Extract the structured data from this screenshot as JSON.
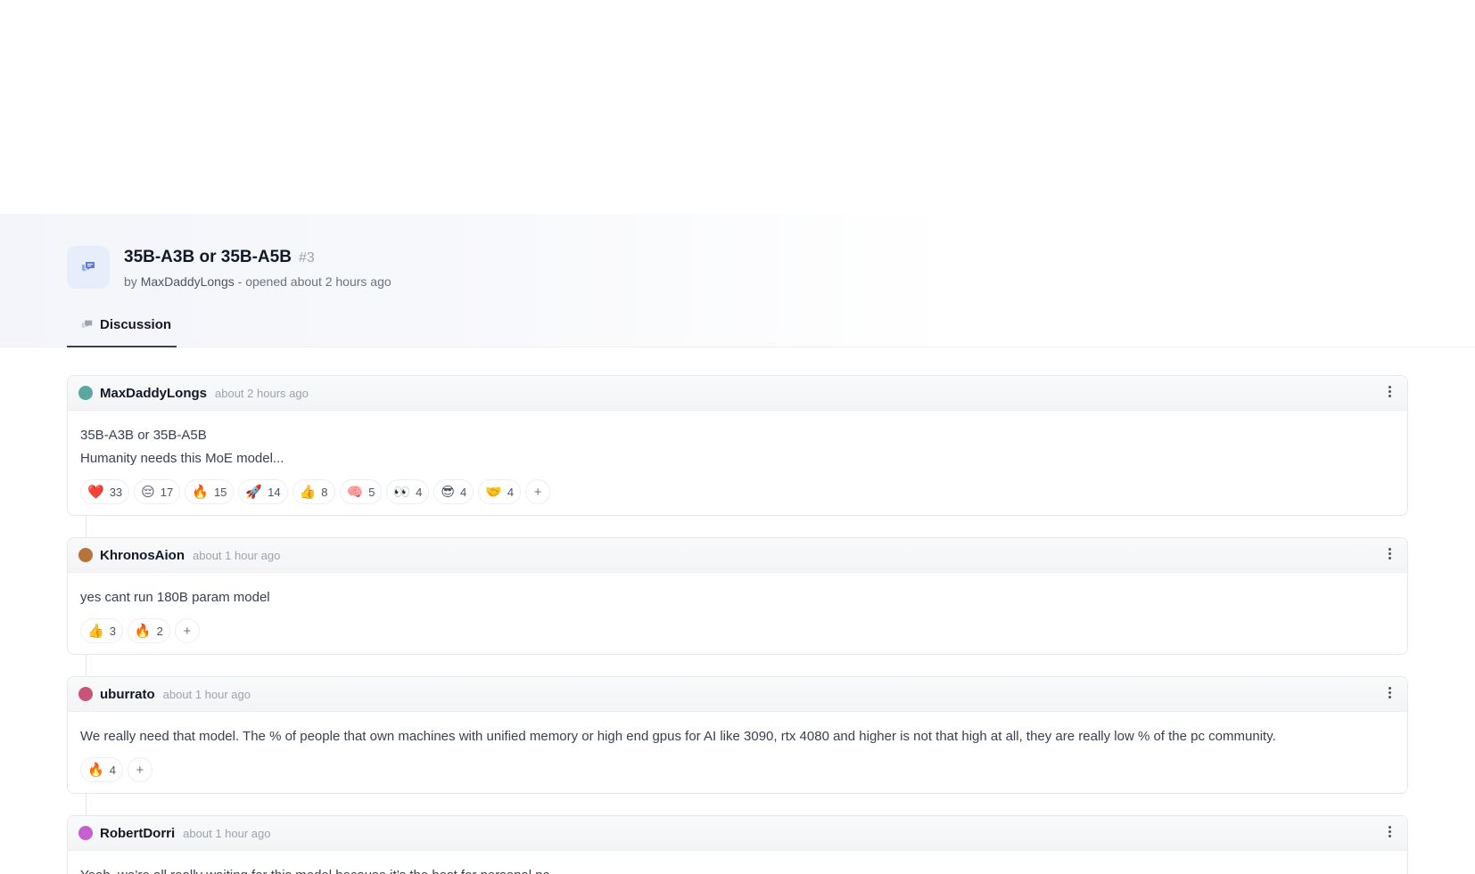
{
  "discussion": {
    "title": "35B-A3B or 35B-A5B",
    "number": "#3",
    "by_label": "by",
    "author": "MaxDaddyLongs",
    "opened_text": "- opened about 2 hours ago",
    "tab_label": "Discussion"
  },
  "comments": [
    {
      "user": "MaxDaddyLongs",
      "time": "about 2 hours ago",
      "avatar_color": "#5aa8a0",
      "lines": [
        "35B-A3B or 35B-A5B",
        "Humanity needs this MoE model..."
      ],
      "reactions": [
        {
          "emoji": "❤️",
          "count": "33"
        },
        {
          "emoji": "😔",
          "count": "17"
        },
        {
          "emoji": "🔥",
          "count": "15"
        },
        {
          "emoji": "🚀",
          "count": "14"
        },
        {
          "emoji": "👍",
          "count": "8"
        },
        {
          "emoji": "🧠",
          "count": "5"
        },
        {
          "emoji": "👀",
          "count": "4"
        },
        {
          "emoji": "😎",
          "count": "4"
        },
        {
          "emoji": "🤝",
          "count": "4"
        }
      ]
    },
    {
      "user": "KhronosAion",
      "time": "about 1 hour ago",
      "avatar_color": "#b5733a",
      "lines": [
        "yes cant run 180B param model"
      ],
      "reactions": [
        {
          "emoji": "👍",
          "count": "3"
        },
        {
          "emoji": "🔥",
          "count": "2"
        }
      ]
    },
    {
      "user": "uburrato",
      "time": "about 1 hour ago",
      "avatar_color": "#c9547a",
      "lines": [
        "We really need that model. The % of people that own machines with unified memory or high end gpus for AI like 3090, rtx 4080 and higher is not that high at all, they are really low % of the pc community."
      ],
      "reactions": [
        {
          "emoji": "🔥",
          "count": "4"
        }
      ]
    },
    {
      "user": "RobertDorri",
      "time": "about 1 hour ago",
      "avatar_color": "#c65fd0",
      "lines": [
        "Yeah, we’re all really waiting for this model because it’s the best for personal pc"
      ],
      "reactions": []
    }
  ],
  "add_reaction_label": "+"
}
